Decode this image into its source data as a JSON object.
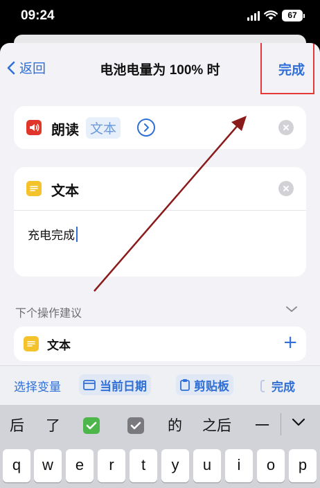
{
  "status_bar": {
    "time": "09:24",
    "battery": "67"
  },
  "nav": {
    "back_label": "返回",
    "title": "电池电量为 100% 时",
    "done_label": "完成"
  },
  "actions": {
    "speak": {
      "label": "朗读",
      "param": "文本"
    },
    "text": {
      "label": "文本",
      "value": "充电完成"
    }
  },
  "suggestions": {
    "header": "下个操作建议",
    "items": [
      {
        "label": "文本",
        "add": "+"
      }
    ]
  },
  "variable_bar": {
    "select_label": "选择变量",
    "chips": [
      {
        "label": "当前日期"
      },
      {
        "label": "剪贴板"
      }
    ],
    "done_label": "完成"
  },
  "keyboard": {
    "candidates": [
      "后",
      "了",
      "的",
      "之后",
      "一"
    ],
    "emoji_candidates": [
      "check-box-green",
      "check-box-gray"
    ],
    "keys": [
      "q",
      "w",
      "e",
      "r",
      "t",
      "y",
      "u",
      "i",
      "o",
      "p"
    ]
  },
  "colors": {
    "accent": "#2f6fd6",
    "highlight": "#e53935",
    "annotation_arrow": "#8b1a1a"
  }
}
